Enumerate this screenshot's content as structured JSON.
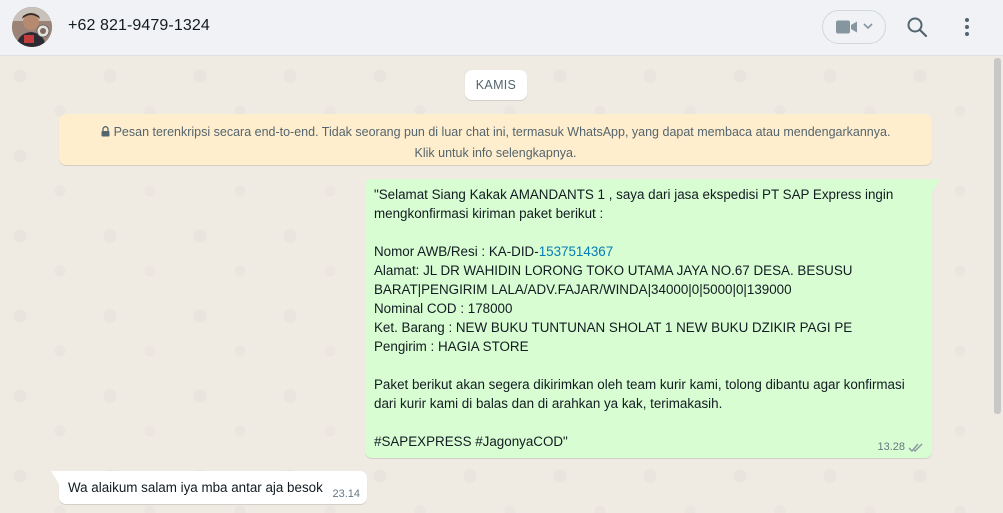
{
  "header": {
    "contact_name": "+62 821-9479-1324",
    "avatar_icon": "person-photo-avatar",
    "video_icon": "video-camera-icon",
    "search_icon": "search-icon",
    "menu_icon": "more-vertical-icon"
  },
  "chat": {
    "date_chip": "KAMIS",
    "encryption_line1": "Pesan terenkripsi secara end-to-end. Tidak seorang pun di luar chat ini, termasuk WhatsApp, yang dapat membaca atau mendengarkannya.",
    "encryption_line2": "Klik untuk info selengkapnya.",
    "outgoing": {
      "text_before_link": "\"Selamat Siang Kakak AMANDANTS 1 , saya dari jasa ekspedisi PT SAP Express ingin\nmengkonfirmasi kiriman paket berikut :\n\nNomor AWB/Resi : KA-DID-",
      "link_text": "1537514367",
      "text_after_link": "\nAlamat: JL DR WAHIDIN LORONG TOKO UTAMA JAYA NO.67 DESA. BESUSU\nBARAT|PENGIRIM LALA/ADV.FAJAR/WINDA|34000|0|5000|0|139000\nNominal COD : 178000\nKet. Barang : NEW BUKU TUNTUNAN SHOLAT 1 NEW BUKU DZIKIR PAGI PE\nPengirim : HAGIA STORE\n\nPaket berikut akan segera dikirimkan oleh team kurir kami, tolong dibantu agar konfirmasi\ndari kurir kami di balas dan di arahkan ya kak, terimakasih.\n\n#SAPEXPRESS #JagonyaCOD\"",
      "time": "13.28",
      "status_icon": "double-check-icon"
    },
    "incoming": {
      "text": "Wa alaikum salam iya mba antar aja besok",
      "time": "23.14"
    }
  },
  "colors": {
    "header_bg": "#f0f2f5",
    "chat_bg": "#efeae2",
    "outgoing_bubble": "#d9fdd3",
    "incoming_bubble": "#ffffff",
    "encryption_bg": "#ffeecd",
    "link": "#027eb5"
  }
}
